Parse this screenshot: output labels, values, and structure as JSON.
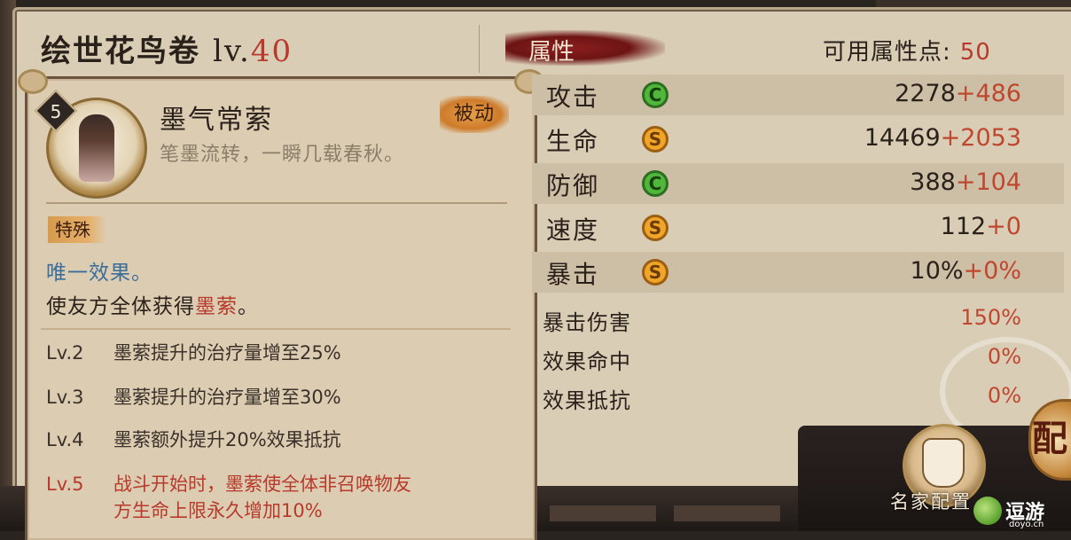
{
  "title": {
    "name": "绘世花鸟卷",
    "lv_prefix": "lv.",
    "level": "40"
  },
  "skill": {
    "level": "5",
    "name": "墨气常萦",
    "description": "笔墨流转，一瞬几载春秋。",
    "tag": "被动",
    "category": "特殊",
    "unique": "唯一效果。",
    "effect_prefix": "使友方全体获得",
    "effect_keyword": "墨萦",
    "effect_suffix": "。",
    "levels": [
      {
        "lv": "Lv.2",
        "text": "墨萦提升的治疗量增至25%"
      },
      {
        "lv": "Lv.3",
        "text": "墨萦提升的治疗量增至30%"
      },
      {
        "lv": "Lv.4",
        "text": "墨萦额外提升20%效果抵抗"
      },
      {
        "lv": "Lv.5",
        "text": "战斗开始时，墨萦使全体非召唤物友",
        "text2": "方生命上限永久增加10%"
      }
    ]
  },
  "attributes": {
    "header": "属性",
    "points_label": "可用属性点:",
    "points_value": "50",
    "stats": [
      {
        "name": "攻击",
        "icon": "green-rank-icon",
        "icon_letter": "C",
        "base": "2278",
        "bonus": "+486"
      },
      {
        "name": "生命",
        "icon": "orange-rank-icon",
        "icon_letter": "S",
        "base": "14469",
        "bonus": "+2053"
      },
      {
        "name": "防御",
        "icon": "green-rank-icon",
        "icon_letter": "C",
        "base": "388",
        "bonus": "+104"
      },
      {
        "name": "速度",
        "icon": "orange-rank-icon",
        "icon_letter": "S",
        "base": "112",
        "bonus": "+0"
      },
      {
        "name": "暴击",
        "icon": "orange-rank-icon",
        "icon_letter": "S",
        "base": "10%",
        "bonus": "+0%"
      }
    ],
    "sub_stats": [
      {
        "name": "暴击伤害",
        "value": "150%"
      },
      {
        "name": "效果命中",
        "value": "0%"
      },
      {
        "name": "效果抵抗",
        "value": "0%"
      }
    ]
  },
  "bottom": {
    "famous_config": "名家配置",
    "config_badge": "配"
  },
  "watermark": {
    "text": "逗游",
    "sub": "doyo.cn"
  },
  "colors": {
    "accent_red": "#b73a2c",
    "bonus_red": "#c0472f",
    "rank_green": "#4fb83a",
    "rank_orange": "#f0a528",
    "unique_blue": "#3c6e9b"
  }
}
